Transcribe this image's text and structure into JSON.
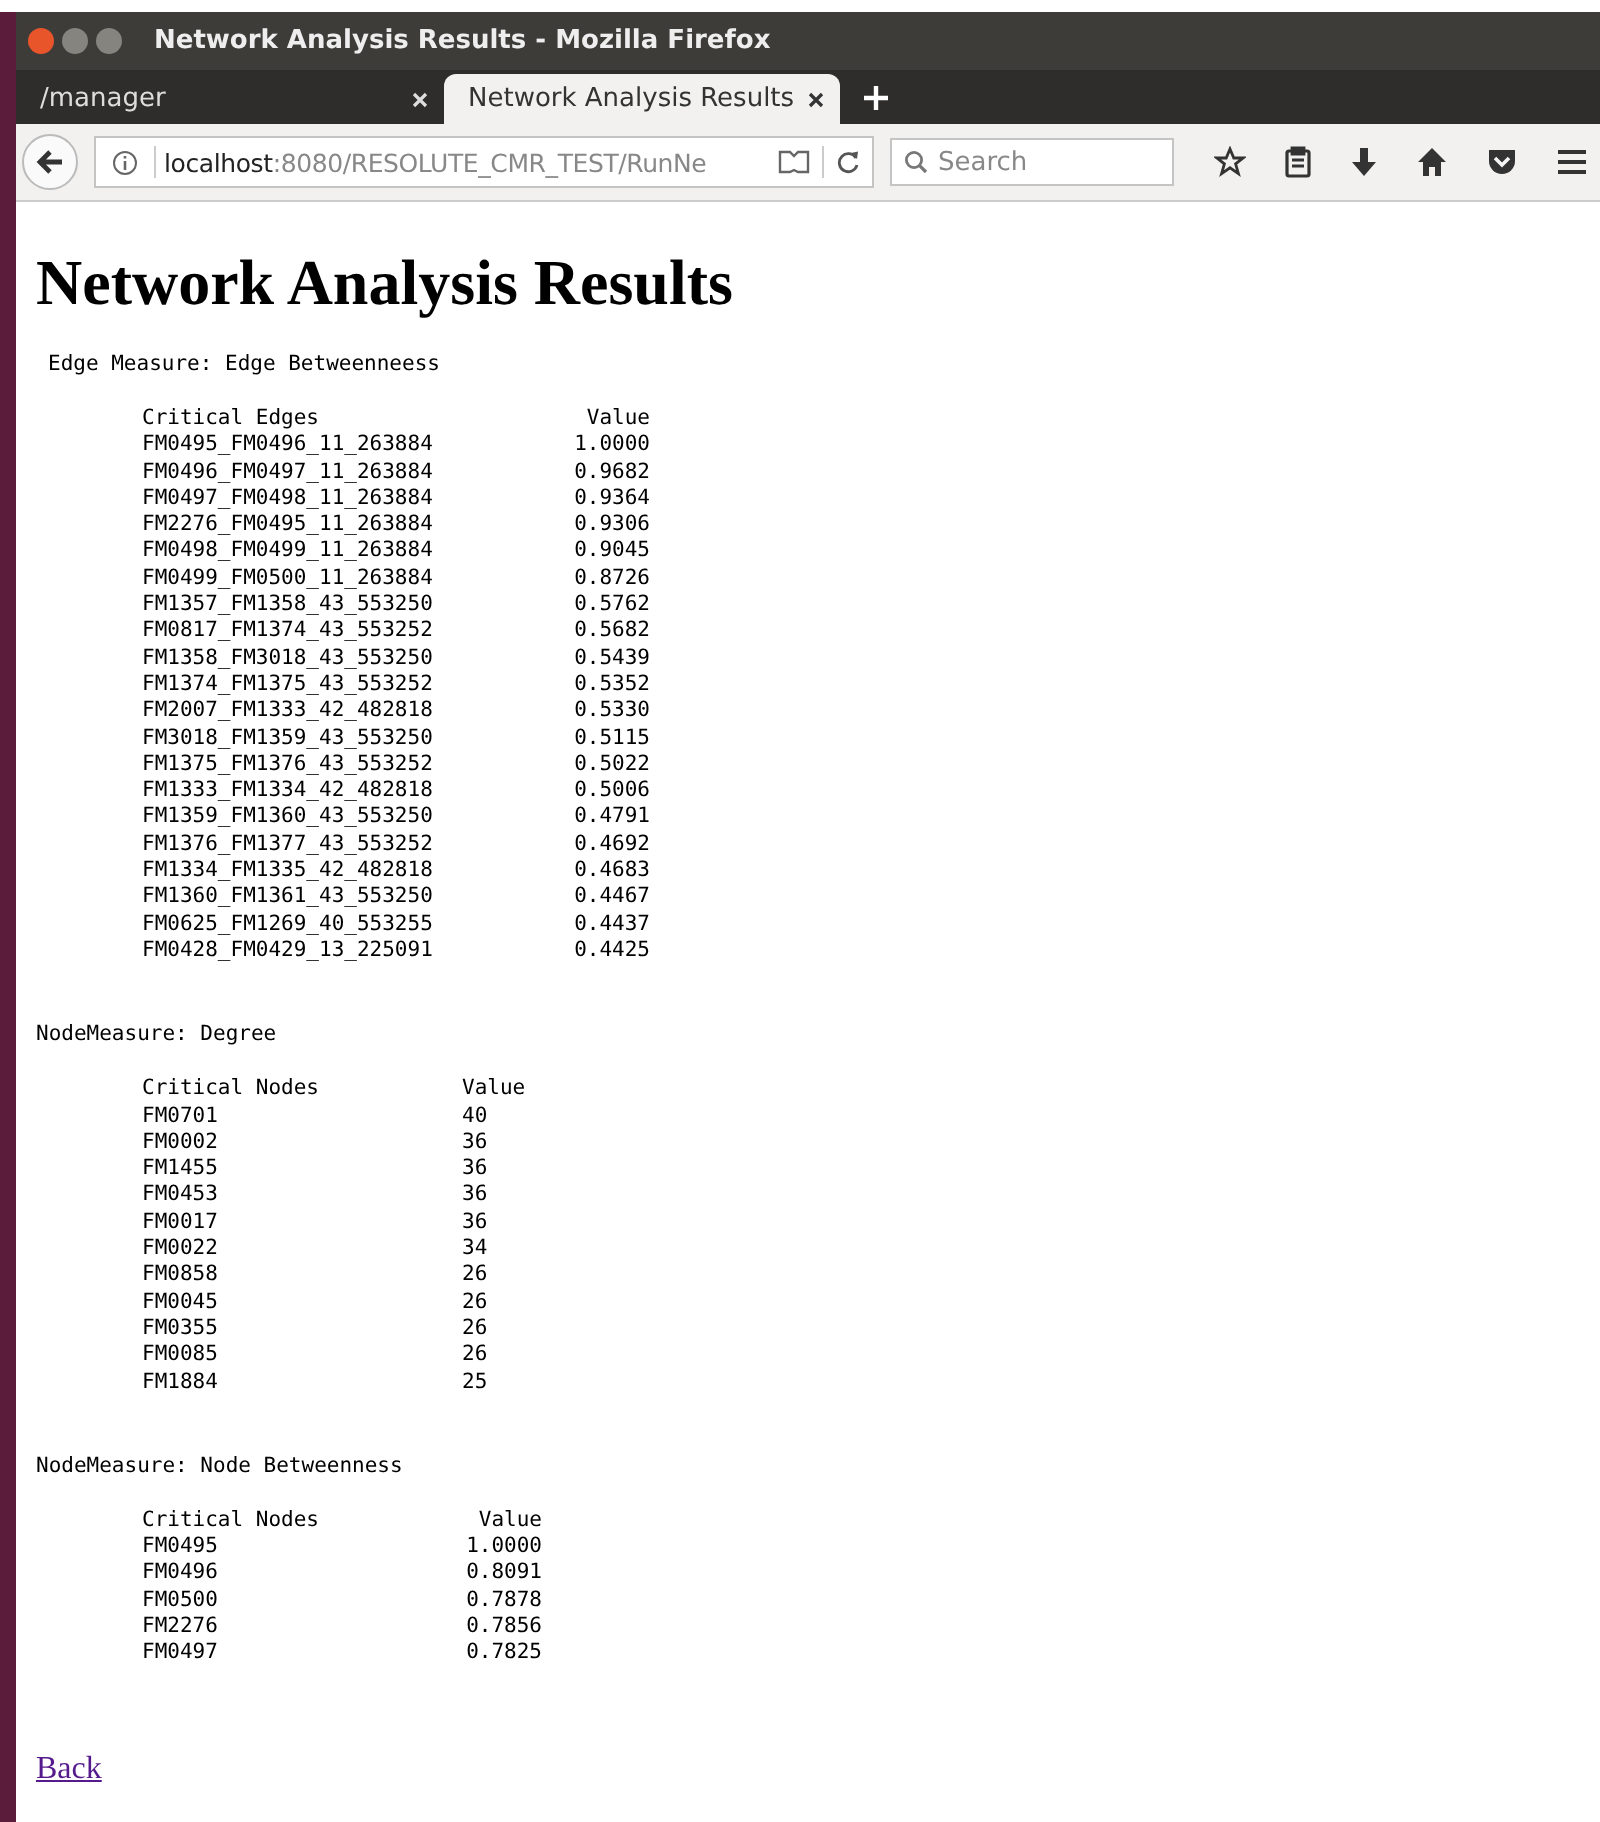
{
  "window": {
    "title": "Network Analysis Results - Mozilla Firefox"
  },
  "tabs": [
    {
      "label": "/manager",
      "selected": false
    },
    {
      "label": "Network Analysis Results",
      "selected": true
    }
  ],
  "address_bar": {
    "host": "localhost",
    "path": ":8080/RESOLUTE_CMR_TEST/RunNe"
  },
  "search": {
    "placeholder": "Search"
  },
  "page": {
    "heading": "Network Analysis Results",
    "sections": [
      {
        "kind": "edge_scores",
        "measure": "Edge Measure: Edge Betweenneess",
        "columns": [
          "Critical Edges",
          "Value"
        ],
        "rows": [
          [
            "FM0495_FM0496_11_263884",
            "1.0000"
          ],
          [
            "FM0496_FM0497_11_263884",
            "0.9682"
          ],
          [
            "FM0497_FM0498_11_263884",
            "0.9364"
          ],
          [
            "FM2276_FM0495_11_263884",
            "0.9306"
          ],
          [
            "FM0498_FM0499_11_263884",
            "0.9045"
          ],
          [
            "FM0499_FM0500_11_263884",
            "0.8726"
          ],
          [
            "FM1357_FM1358_43_553250",
            "0.5762"
          ],
          [
            "FM0817_FM1374_43_553252",
            "0.5682"
          ],
          [
            "FM1358_FM3018_43_553250",
            "0.5439"
          ],
          [
            "FM1374_FM1375_43_553252",
            "0.5352"
          ],
          [
            "FM2007_FM1333_42_482818",
            "0.5330"
          ],
          [
            "FM3018_FM1359_43_553250",
            "0.5115"
          ],
          [
            "FM1375_FM1376_43_553252",
            "0.5022"
          ],
          [
            "FM1333_FM1334_42_482818",
            "0.5006"
          ],
          [
            "FM1359_FM1360_43_553250",
            "0.4791"
          ],
          [
            "FM1376_FM1377_43_553252",
            "0.4692"
          ],
          [
            "FM1334_FM1335_42_482818",
            "0.4683"
          ],
          [
            "FM1360_FM1361_43_553250",
            "0.4467"
          ],
          [
            "FM0625_FM1269_40_553255",
            "0.4437"
          ],
          [
            "FM0428_FM0429_13_225091",
            "0.4425"
          ]
        ]
      },
      {
        "kind": "node_counts",
        "measure": "NodeMeasure: Degree",
        "columns": [
          "Critical Nodes",
          "Value"
        ],
        "rows": [
          [
            "FM0701",
            "40"
          ],
          [
            "FM0002",
            "36"
          ],
          [
            "FM1455",
            "36"
          ],
          [
            "FM0453",
            "36"
          ],
          [
            "FM0017",
            "36"
          ],
          [
            "FM0022",
            "34"
          ],
          [
            "FM0858",
            "26"
          ],
          [
            "FM0045",
            "26"
          ],
          [
            "FM0355",
            "26"
          ],
          [
            "FM0085",
            "26"
          ],
          [
            "FM1884",
            "25"
          ]
        ]
      },
      {
        "kind": "node_scores",
        "measure": "NodeMeasure: Node Betweenness",
        "columns": [
          "Critical Nodes",
          "Value"
        ],
        "rows": [
          [
            "FM0495",
            "1.0000"
          ],
          [
            "FM0496",
            "0.8091"
          ],
          [
            "FM0500",
            "0.7878"
          ],
          [
            "FM2276",
            "0.7856"
          ],
          [
            "FM0497",
            "0.7825"
          ]
        ]
      }
    ],
    "back_link": "Back"
  }
}
